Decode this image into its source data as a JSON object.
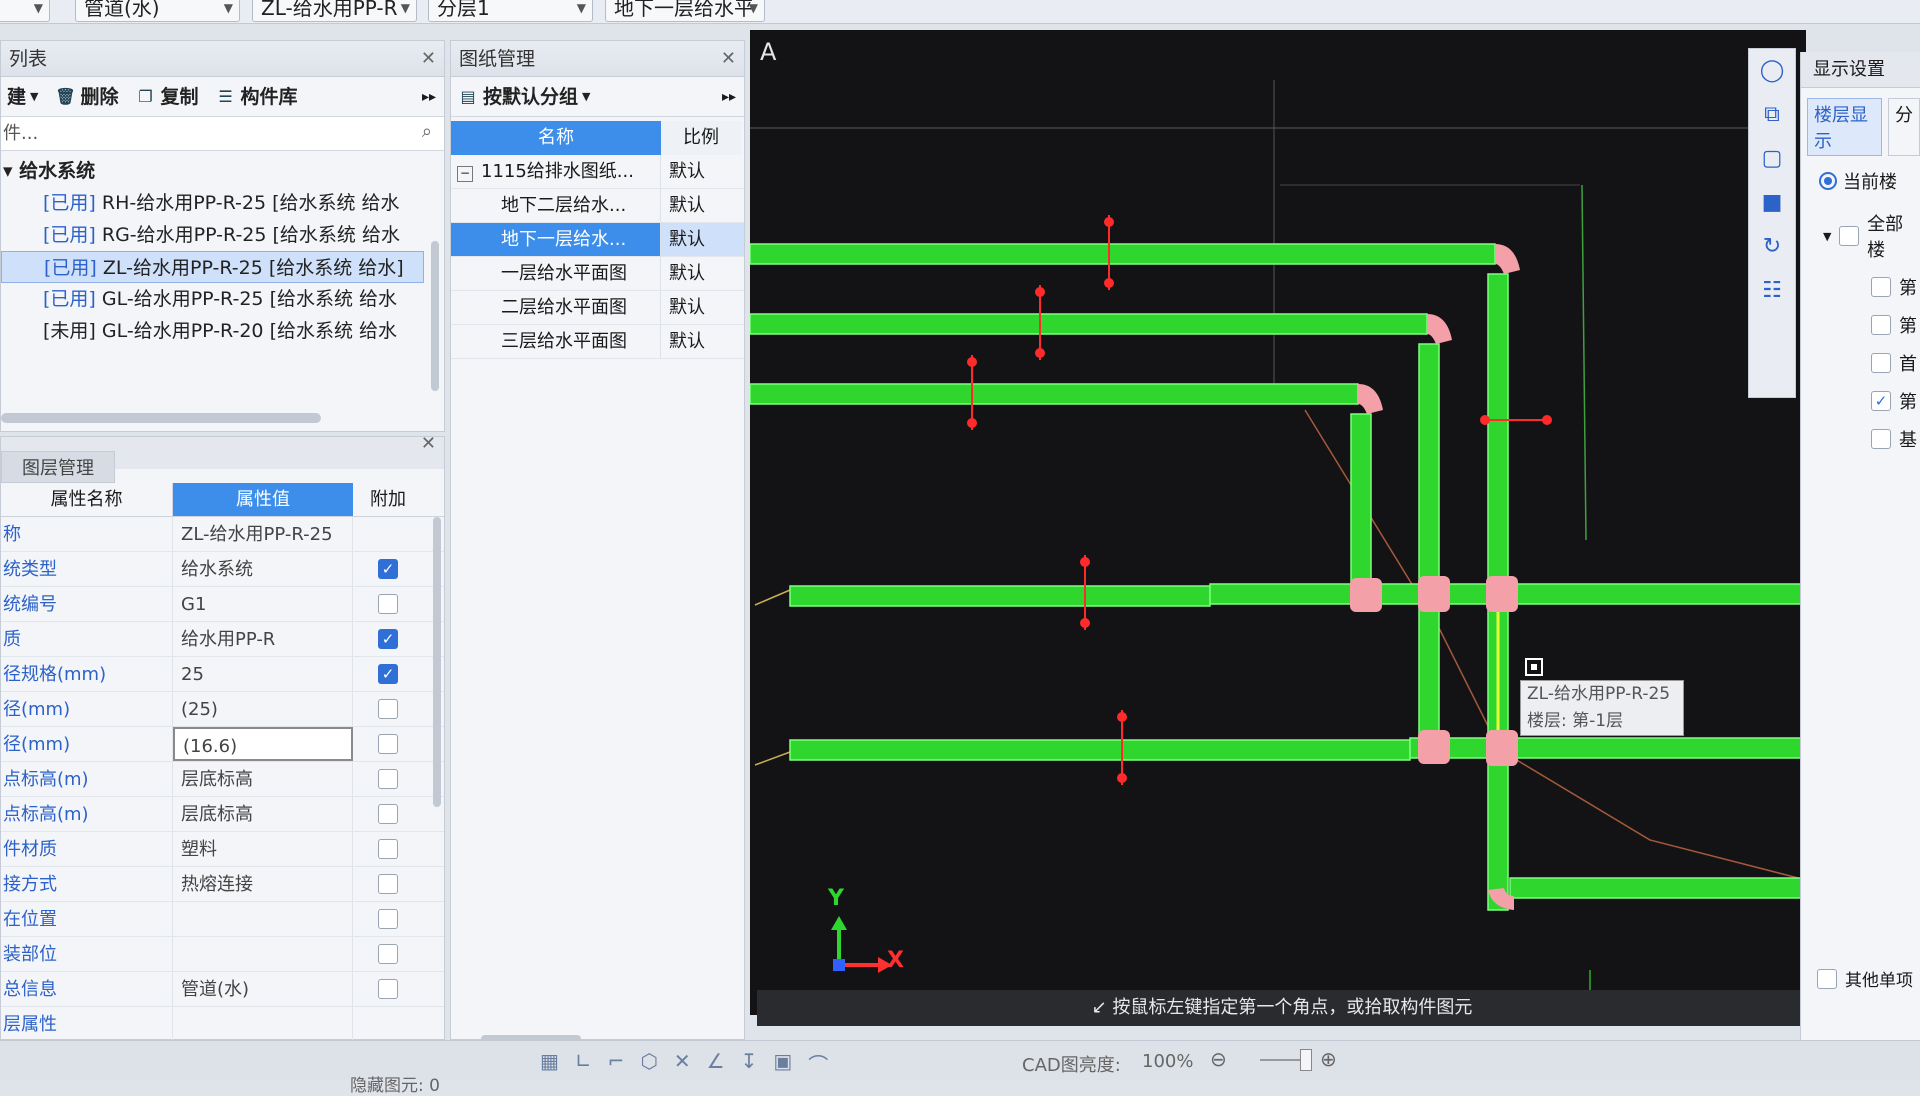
{
  "topbar": {
    "combo1": "管道(水)",
    "combo2": "ZL-给水用PP-R",
    "combo3": "分层1",
    "combo4": "地下一层给水平"
  },
  "component_list": {
    "title": "列表",
    "toolbar": {
      "new": "建",
      "delete": "删除",
      "copy": "复制",
      "library": "构件库"
    },
    "search_placeholder": "件...",
    "group": "给水系统",
    "items": [
      {
        "status": "[已用]",
        "label": "RH-给水用PP-R-25 [给水系统 给水"
      },
      {
        "status": "[已用]",
        "label": "RG-给水用PP-R-25 [给水系统 给水"
      },
      {
        "status": "[已用]",
        "label": "ZL-给水用PP-R-25 [给水系统 给水]"
      },
      {
        "status": "[已用]",
        "label": "GL-给水用PP-R-25 [给水系统 给水"
      },
      {
        "status": "[未用]",
        "label": "GL-给水用PP-R-20 [给水系统 给水"
      }
    ]
  },
  "layer_tab": "图层管理",
  "properties": {
    "headers": {
      "name": "属性名称",
      "value": "属性值",
      "extra": "附加"
    },
    "rows": [
      {
        "name": "称",
        "value": "ZL-给水用PP-R-25",
        "checkbox": "none"
      },
      {
        "name": "统类型",
        "value": "给水系统",
        "checkbox": "checked"
      },
      {
        "name": "统编号",
        "value": "G1",
        "checkbox": "unchecked"
      },
      {
        "name": "质",
        "value": "给水用PP-R",
        "checkbox": "checked"
      },
      {
        "name": "径规格(mm)",
        "value": "25",
        "checkbox": "checked"
      },
      {
        "name": "径(mm)",
        "value": "(25)",
        "checkbox": "unchecked"
      },
      {
        "name": "径(mm)",
        "value": "(16.6)",
        "checkbox": "unchecked"
      },
      {
        "name": "点标高(m)",
        "value": "层底标高",
        "checkbox": "unchecked"
      },
      {
        "name": "点标高(m)",
        "value": "层底标高",
        "checkbox": "unchecked"
      },
      {
        "name": "件材质",
        "value": "塑料",
        "checkbox": "unchecked"
      },
      {
        "name": "接方式",
        "value": "热熔连接",
        "checkbox": "unchecked"
      },
      {
        "name": "在位置",
        "value": "",
        "checkbox": "unchecked"
      },
      {
        "name": "装部位",
        "value": "",
        "checkbox": "unchecked"
      },
      {
        "name": "总信息",
        "value": "管道(水)",
        "checkbox": "unchecked"
      },
      {
        "name": "层属性",
        "value": "",
        "checkbox": "none"
      }
    ]
  },
  "drawing_mgmt": {
    "title": "图纸管理",
    "group_button": "按默认分组",
    "headers": {
      "name": "名称",
      "ratio": "比例"
    },
    "rows": [
      {
        "name": "1115给排水图纸...",
        "ratio": "默认"
      },
      {
        "name": "地下二层给水...",
        "ratio": "默认"
      },
      {
        "name": "地下一层给水...",
        "ratio": "默认"
      },
      {
        "name": "一层给水平面图",
        "ratio": "默认"
      },
      {
        "name": "二层给水平面图",
        "ratio": "默认"
      },
      {
        "name": "三层给水平面图",
        "ratio": "默认"
      }
    ]
  },
  "canvas": {
    "corner_label": "A",
    "tooltip_line1": "ZL-给水用PP-R-25",
    "tooltip_line2": "楼层: 第-1层",
    "axis_x": "X",
    "axis_y": "Y",
    "status": "按鼠标左键指定第一个角点，或拾取构件图元"
  },
  "display_settings": {
    "title": "显示设置",
    "tab1": "楼层显示",
    "tab2": "分",
    "radio_current": "当前楼",
    "all_label": "全部楼",
    "floors": [
      {
        "label": "第",
        "checked": false
      },
      {
        "label": "第",
        "checked": false
      },
      {
        "label": "首",
        "checked": false
      },
      {
        "label": "第",
        "checked": true
      },
      {
        "label": "基",
        "checked": false
      }
    ],
    "other_item": "其他单项"
  },
  "bottombar": {
    "cad_brightness_label": "CAD图亮度:",
    "cad_brightness_value": "100%",
    "hidden_label": "隐藏图元: 0"
  },
  "colors": {
    "pipe": "#2ed62e",
    "joint": "#f3a0a8",
    "marker": "#ff2b2b",
    "accent": "#2f6fd6"
  }
}
